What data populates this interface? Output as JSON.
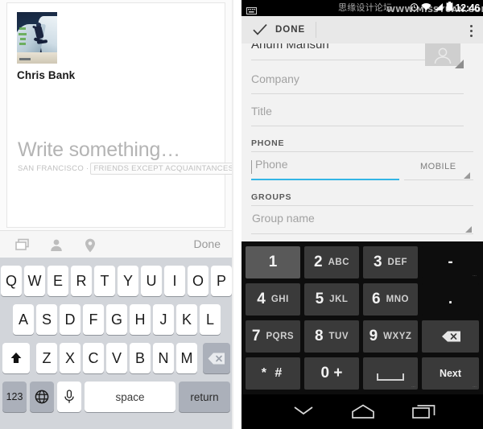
{
  "left_panel": {
    "app": "facebook-compose",
    "profile": {
      "name": "Chris Bank",
      "avatar_alt": "snowboarder-photo"
    },
    "composer": {
      "placeholder": "Write something…",
      "location": "SAN FRANCISCO ·",
      "audience": "FRIENDS EXCEPT ACQUAINTANCES"
    },
    "toolbar": {
      "icons": [
        {
          "name": "photo-icon",
          "label": "Photo"
        },
        {
          "name": "tag-person-icon",
          "label": "Tag People"
        },
        {
          "name": "location-pin-icon",
          "label": "Check In"
        }
      ],
      "done_label": "Done"
    },
    "keyboard": {
      "type": "ios-qwerty",
      "row1": [
        "Q",
        "W",
        "E",
        "R",
        "T",
        "Y",
        "U",
        "I",
        "O",
        "P"
      ],
      "row2": [
        "A",
        "S",
        "D",
        "F",
        "G",
        "H",
        "J",
        "K",
        "L"
      ],
      "row3": [
        "Z",
        "X",
        "C",
        "V",
        "B",
        "N",
        "M"
      ],
      "shift_label": "shift",
      "backspace_label": "delete",
      "numbers_label": "123",
      "globe_label": "globe",
      "mic_label": "dictation",
      "space_label": "space",
      "return_label": "return"
    }
  },
  "right_panel": {
    "app": "android-contact-editor",
    "status_bar": {
      "time": "12:46",
      "icons": [
        "keyboard-icon",
        "alarm-icon",
        "wifi-icon",
        "signal-icon",
        "battery-icon"
      ],
      "watermark_cn": "思缘设计论坛",
      "watermark_url": "WWW.MISSYUAN.COM"
    },
    "action_bar": {
      "done_label": "DONE",
      "overflow_label": "More options"
    },
    "form": {
      "name_value": "Anum Mansuri",
      "fields": [
        {
          "label": "Company",
          "value": ""
        },
        {
          "label": "Title",
          "value": ""
        }
      ],
      "sections": [
        {
          "label": "PHONE",
          "input_placeholder": "Phone",
          "type_label": "MOBILE",
          "focused": true
        },
        {
          "label": "GROUPS",
          "input_placeholder": "Group name",
          "focused": false
        }
      ],
      "accent_color": "#33b5e5"
    },
    "keypad": {
      "type": "android-phone",
      "keys": [
        {
          "num": "1",
          "sub": "",
          "variant": "light"
        },
        {
          "num": "2",
          "sub": "ABC",
          "variant": "dark"
        },
        {
          "num": "3",
          "sub": "DEF",
          "variant": "dark"
        },
        {
          "num": "-",
          "sub": "",
          "variant": "plain"
        },
        {
          "num": "4",
          "sub": "GHI",
          "variant": "dark"
        },
        {
          "num": "5",
          "sub": "JKL",
          "variant": "dark"
        },
        {
          "num": "6",
          "sub": "MNO",
          "variant": "dark"
        },
        {
          "num": ".",
          "sub": "",
          "variant": "plain"
        },
        {
          "num": "7",
          "sub": "PQRS",
          "variant": "dark"
        },
        {
          "num": "8",
          "sub": "TUV",
          "variant": "dark"
        },
        {
          "num": "9",
          "sub": "WXYZ",
          "variant": "dark"
        },
        {
          "num": "",
          "sub": "",
          "variant": "dark"
        },
        {
          "num": "* #",
          "sub": "",
          "variant": "dark"
        },
        {
          "num": "0 +",
          "sub": "",
          "variant": "dark"
        },
        {
          "num": "",
          "sub": "",
          "variant": "dark"
        },
        {
          "num": "Next",
          "sub": "",
          "variant": "dark"
        }
      ],
      "backspace_label": "Backspace",
      "next_label": "Next",
      "space_label": "Space"
    },
    "nav_bar": {
      "back_label": "Hide keyboard",
      "home_label": "Home",
      "recents_label": "Recent apps"
    }
  }
}
